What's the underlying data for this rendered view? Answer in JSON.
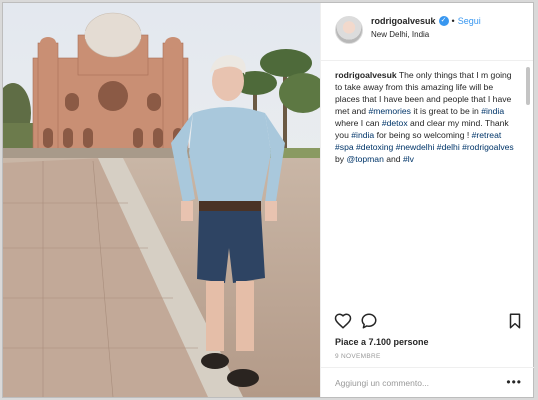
{
  "post": {
    "username": "rodrigoalvesuk",
    "follow_label": "Segui",
    "location": "New Delhi, India",
    "caption": {
      "author": "rodrigoalvesuk",
      "text_1": " The only things that I m going to take away from this amazing life will be places that I have been and people that I have met and ",
      "tag_memories": "#memories",
      "text_2": " it is great to be in ",
      "tag_india": "#india",
      "text_3": " where I can ",
      "tag_detox": "#detox",
      "text_4": " and clear my mind. Thank you ",
      "tag_india2": "#india",
      "text_5": " for being so welcoming ! ",
      "tag_retreat": "#retreat",
      "sp1": " ",
      "tag_spa": "#spa",
      "sp2": " ",
      "tag_detoxing": "#detoxing",
      "sp3": " ",
      "tag_newdelhi": "#newdelhi",
      "sp4": " ",
      "tag_delhi": "#delhi",
      "sp5": " ",
      "tag_rodrigoalves": "#rodrigoalves",
      "text_6": " by ",
      "mention_topman": "@topman",
      "text_7": " and ",
      "tag_lv": "#lv"
    },
    "likes_label": "Piace a 7.100 persone",
    "date_label": "9 NOVEMBRE",
    "comment_placeholder": "Aggiungi un commento...",
    "comment_more": "•••"
  },
  "icons": {
    "verified": "verified-badge-icon",
    "like": "heart-icon",
    "comment": "comment-bubble-icon",
    "save": "bookmark-icon"
  },
  "colors": {
    "link_blue": "#3897f0",
    "hashtag": "#003569",
    "muted": "#999999"
  }
}
